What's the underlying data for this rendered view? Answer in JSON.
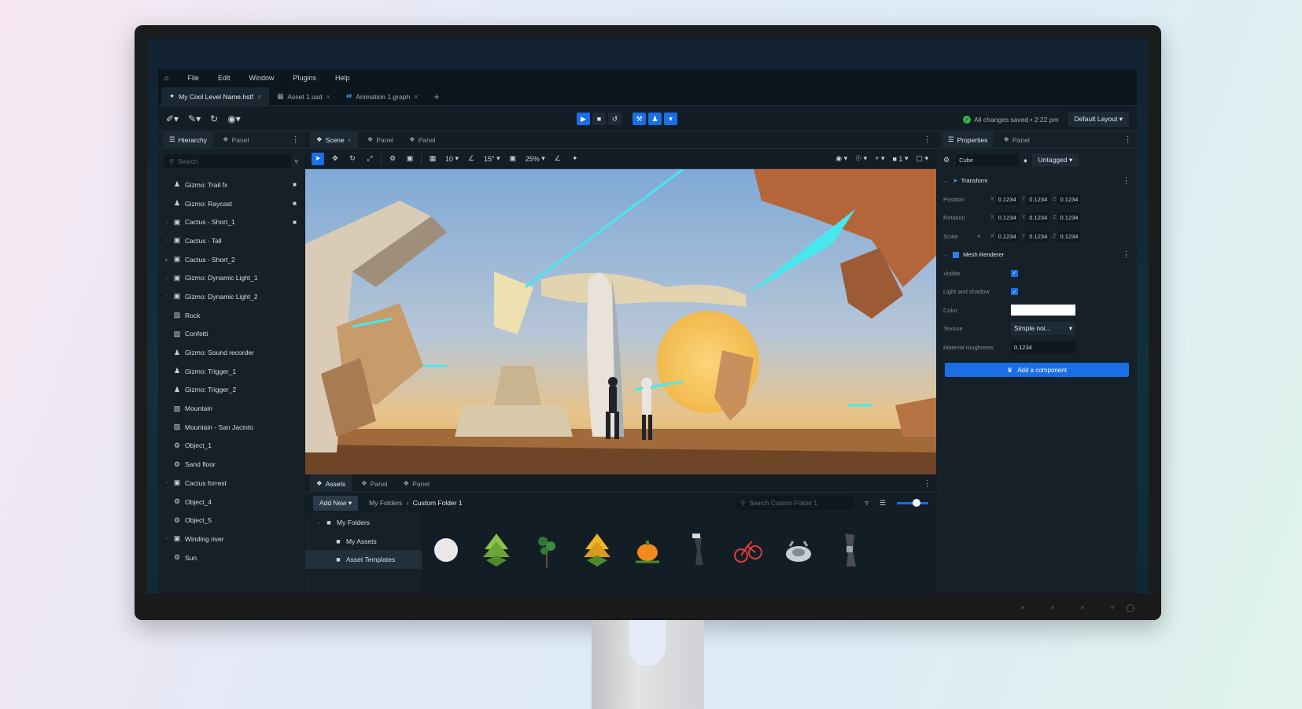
{
  "menu": [
    "File",
    "Edit",
    "Window",
    "Plugins",
    "Help"
  ],
  "tabs": [
    {
      "label": "My Cool Level Name.hstf",
      "active": true
    },
    {
      "label": "Asset 1.usd",
      "active": false
    },
    {
      "label": "Animation 1.graph",
      "active": false
    }
  ],
  "toolbar": {
    "saved_text": "All changes saved • 2:22 pm",
    "layout": "Default Layout"
  },
  "hierarchy": {
    "tabs": [
      "Hierarchy",
      "Panel"
    ],
    "search_placeholder": "Search",
    "items": [
      {
        "label": "Gizmo: Trail fx",
        "icon": "person-icon",
        "locked": true,
        "arrow": ""
      },
      {
        "label": "Gizmo: Raycast",
        "icon": "person-icon",
        "locked": true,
        "arrow": ""
      },
      {
        "label": "Cactus - Short_1",
        "icon": "mesh-icon",
        "locked": true,
        "arrow": "›"
      },
      {
        "label": "Cactus - Tall",
        "icon": "mesh-icon",
        "locked": false,
        "arrow": "›"
      },
      {
        "label": "Cactus - Short_2",
        "icon": "mesh-icon",
        "locked": false,
        "arrow": "▸"
      },
      {
        "label": "Gizmo: Dynamic Light_1",
        "icon": "mesh-icon",
        "locked": false,
        "arrow": "›"
      },
      {
        "label": "Gizmo: Dynamic Light_2",
        "icon": "mesh-icon",
        "locked": false,
        "arrow": "›"
      },
      {
        "label": "Rock",
        "icon": "image-icon",
        "locked": false,
        "arrow": ""
      },
      {
        "label": "Confetti",
        "icon": "image-icon",
        "locked": false,
        "arrow": ""
      },
      {
        "label": "Gizmo: Sound recorder",
        "icon": "person-icon",
        "locked": false,
        "arrow": ""
      },
      {
        "label": "Gizmo: Trigger_1",
        "icon": "person-icon",
        "locked": false,
        "arrow": ""
      },
      {
        "label": "Gizmo: Trigger_2",
        "icon": "person-icon",
        "locked": false,
        "arrow": ""
      },
      {
        "label": "Mountain",
        "icon": "image-icon",
        "locked": false,
        "arrow": ""
      },
      {
        "label": "Mountain - San Jacinto",
        "icon": "image-icon",
        "locked": false,
        "arrow": ""
      },
      {
        "label": "Object_1",
        "icon": "globe-icon",
        "locked": false,
        "arrow": ""
      },
      {
        "label": "Sand floor",
        "icon": "globe-icon",
        "locked": false,
        "arrow": ""
      },
      {
        "label": "Cactus forrest",
        "icon": "mesh-icon",
        "locked": false,
        "arrow": "›"
      },
      {
        "label": "Object_4",
        "icon": "globe-icon",
        "locked": false,
        "arrow": ""
      },
      {
        "label": "Object_5",
        "icon": "globe-icon",
        "locked": false,
        "arrow": ""
      },
      {
        "label": "Winding river",
        "icon": "mesh-icon",
        "locked": false,
        "arrow": "›"
      },
      {
        "label": "Sun",
        "icon": "globe-icon",
        "locked": false,
        "arrow": ""
      }
    ]
  },
  "scene": {
    "tabs": [
      "Scene",
      "Panel",
      "Panel"
    ],
    "grid": "10",
    "angle": "15°",
    "scale": "25%",
    "camera": "1"
  },
  "assets": {
    "tabs": [
      "Assets",
      "Panel",
      "Panel"
    ],
    "add_new": "Add New",
    "breadcrumb": [
      "My Folders",
      "Custom Folder 1"
    ],
    "search_placeholder": "Search Custom Folder 1",
    "folders": [
      "My Folders",
      "My Assets",
      "Asset Templates"
    ]
  },
  "properties": {
    "tabs": [
      "Properties",
      "Panel"
    ],
    "object_name": "Cube",
    "tag": "Untagged",
    "transform_title": "Transform",
    "position_label": "Position",
    "rotation_label": "Rotation",
    "scale_label": "Scale",
    "value": "0.1234",
    "mesh_title": "Mesh Renderer",
    "visible_label": "Visible",
    "light_label": "Light and shadow",
    "color_label": "Color",
    "texture_label": "Texture",
    "texture_value": "Simple noi...",
    "roughness_label": "Material roughness",
    "roughness_value": "0.1234",
    "add_component": "Add a component"
  }
}
